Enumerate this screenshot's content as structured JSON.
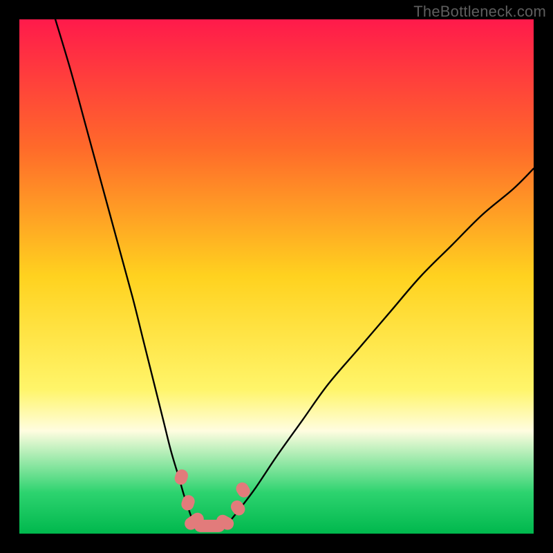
{
  "watermark": "TheBottleneck.com",
  "chart_data": {
    "type": "line",
    "title": "",
    "xlabel": "",
    "ylabel": "",
    "xlim": [
      0,
      100
    ],
    "ylim": [
      0,
      100
    ],
    "gradient_stops": [
      {
        "offset": 0.0,
        "color": "#ff1a4b"
      },
      {
        "offset": 0.25,
        "color": "#ff6a2a"
      },
      {
        "offset": 0.5,
        "color": "#ffd21f"
      },
      {
        "offset": 0.72,
        "color": "#fff56a"
      },
      {
        "offset": 0.8,
        "color": "#fffde0"
      },
      {
        "offset": 0.92,
        "color": "#2dd36f"
      },
      {
        "offset": 1.0,
        "color": "#00b84d"
      }
    ],
    "series": [
      {
        "name": "left-branch",
        "x": [
          7,
          10,
          13,
          16,
          19,
          22,
          24,
          26,
          28,
          29.5,
          31,
          32,
          33,
          33.8
        ],
        "y": [
          100,
          90,
          79,
          68,
          57,
          46,
          38,
          30,
          22,
          16,
          11,
          7.5,
          4.5,
          2.2
        ]
      },
      {
        "name": "right-branch",
        "x": [
          41,
          43,
          46,
          50,
          55,
          60,
          66,
          72,
          78,
          84,
          90,
          96,
          100
        ],
        "y": [
          2.5,
          5,
          9,
          15,
          22,
          29,
          36,
          43,
          50,
          56,
          62,
          67,
          71
        ]
      },
      {
        "name": "valley-floor",
        "x": [
          33.8,
          35,
          37,
          39,
          41
        ],
        "y": [
          2.2,
          1.6,
          1.4,
          1.6,
          2.5
        ]
      }
    ],
    "markers": {
      "name": "sausage-markers",
      "color": "#e27b7b",
      "points": [
        {
          "x": 31.5,
          "y": 11,
          "len": 3,
          "angle": -72
        },
        {
          "x": 32.8,
          "y": 6,
          "len": 3,
          "angle": -72
        },
        {
          "x": 34.0,
          "y": 2.4,
          "len": 4,
          "angle": -35
        },
        {
          "x": 37.0,
          "y": 1.5,
          "len": 6,
          "angle": 0
        },
        {
          "x": 40.0,
          "y": 2.2,
          "len": 3.5,
          "angle": 28
        },
        {
          "x": 42.5,
          "y": 5.0,
          "len": 3,
          "angle": 55
        },
        {
          "x": 43.5,
          "y": 8.5,
          "len": 3,
          "angle": 58
        }
      ]
    }
  }
}
